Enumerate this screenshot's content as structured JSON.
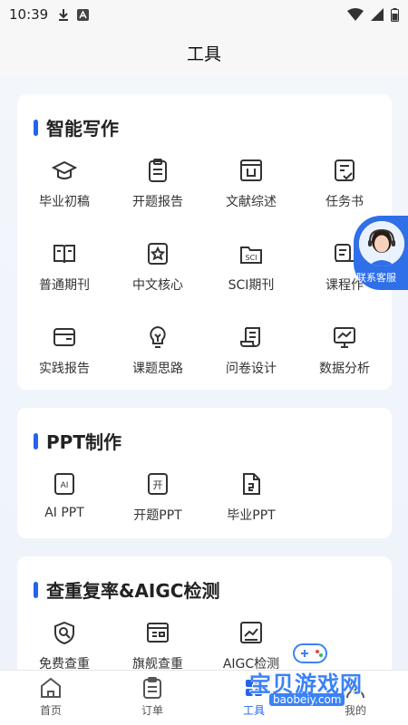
{
  "status_bar": {
    "time": "10:39"
  },
  "header": {
    "title": "工具"
  },
  "sections": [
    {
      "title": "智能写作",
      "items": [
        {
          "label": "毕业初稿",
          "icon": "graduation-cap-icon"
        },
        {
          "label": "开题报告",
          "icon": "clipboard-icon"
        },
        {
          "label": "文献综述",
          "icon": "document-frame-icon"
        },
        {
          "label": "任务书",
          "icon": "task-check-icon"
        },
        {
          "label": "普通期刊",
          "icon": "open-book-icon"
        },
        {
          "label": "中文核心",
          "icon": "star-badge-icon"
        },
        {
          "label": "SCI期刊",
          "icon": "sci-folder-icon"
        },
        {
          "label": "课程作",
          "icon": "course-icon"
        },
        {
          "label": "实践报告",
          "icon": "wallet-card-icon"
        },
        {
          "label": "课题思路",
          "icon": "lightbulb-icon"
        },
        {
          "label": "问卷设计",
          "icon": "scroll-icon"
        },
        {
          "label": "数据分析",
          "icon": "monitor-chart-icon"
        }
      ]
    },
    {
      "title": "PPT制作",
      "items": [
        {
          "label": "AI PPT",
          "icon": "ai-ppt-icon",
          "glyph": "AI"
        },
        {
          "label": "开题PPT",
          "icon": "kaiti-ppt-icon",
          "glyph": "开"
        },
        {
          "label": "毕业PPT",
          "icon": "graduation-ppt-icon"
        }
      ]
    },
    {
      "title": "查重复率&AIGC检测",
      "items": [
        {
          "label": "免费查重",
          "icon": "shield-search-icon"
        },
        {
          "label": "旗舰查重",
          "icon": "id-card-icon"
        },
        {
          "label": "AIGC检测",
          "icon": "chart-frame-icon"
        }
      ]
    }
  ],
  "support_button": {
    "label": "联系客服"
  },
  "tabs": [
    {
      "label": "首页",
      "icon": "home-icon"
    },
    {
      "label": "订单",
      "icon": "order-icon"
    },
    {
      "label": "工具",
      "icon": "tools-icon",
      "active": true
    },
    {
      "label": "我的",
      "icon": "profile-icon"
    }
  ],
  "watermark": {
    "title": "宝贝游戏网",
    "url": "baobeiy.com"
  },
  "colors": {
    "accent": "#2563eb",
    "background": "#eef3fb",
    "card": "#ffffff",
    "support": "#2f6fe8"
  }
}
